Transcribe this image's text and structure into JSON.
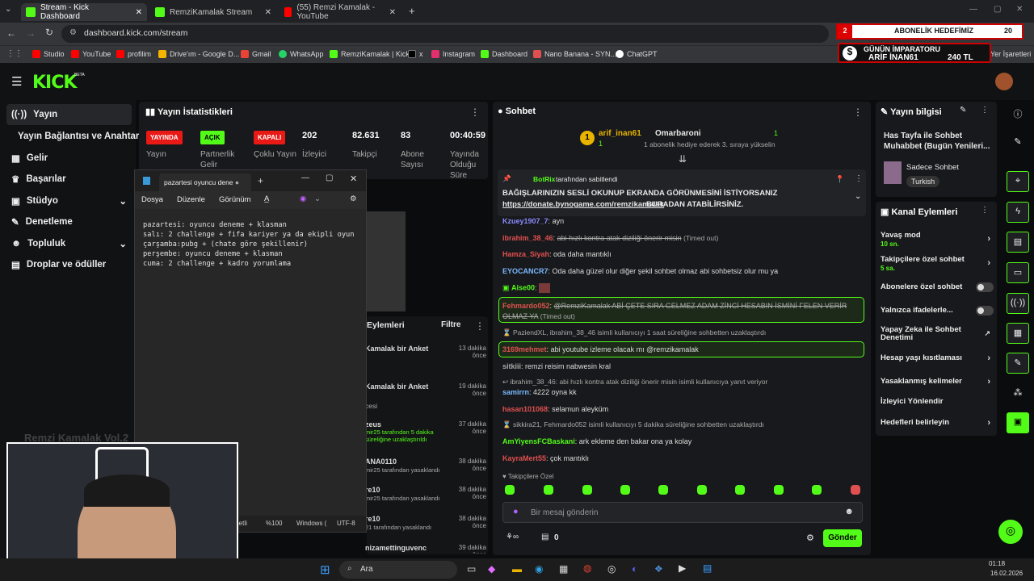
{
  "browser": {
    "tabs": [
      {
        "label": "Stream - Kick Dashboard",
        "color": "#53fc18"
      },
      {
        "label": "RemziKamalak Stream - Wa",
        "color": "#53fc18"
      },
      {
        "label": "(55) Remzi Kamalak - YouTube",
        "color": "#ff0000"
      }
    ],
    "url": "dashboard.kick.com/stream",
    "bookmarks": [
      "Studio",
      "YouTube",
      "profilim",
      "Drive'ım - Google D...",
      "Gmail",
      "WhatsApp",
      "RemziKamalak | Kick",
      "x",
      "Instagram",
      "Dashboard",
      "Nano Banana - SYN...",
      "ChatGPT"
    ],
    "other_bookmarks": "Yer İşaretleri"
  },
  "overlay": {
    "goal_num": "2",
    "goal_label": "ABONELİK HEDEFİMİZ",
    "goal_count": "20",
    "emperor_title": "GÜNÜN İMPARATORU",
    "emperor_name": "ARİF İNAN61",
    "emperor_amount": "240 TL"
  },
  "kick": {
    "logo": "KICK",
    "beta": "BETA"
  },
  "sidebar": {
    "items": [
      {
        "label": "Yayın",
        "icon": "stream-icon"
      },
      {
        "label": "Yayın Bağlantısı ve Anahtarı",
        "icon": "key-icon"
      },
      {
        "label": "Gelir",
        "icon": "money-icon"
      },
      {
        "label": "Başarılar",
        "icon": "trophy-icon"
      },
      {
        "label": "Stüdyo",
        "icon": "studio-icon"
      },
      {
        "label": "Denetleme",
        "icon": "wrench-icon"
      },
      {
        "label": "Topluluk",
        "icon": "people-icon"
      },
      {
        "label": "Droplar ve ödüller",
        "icon": "gift-icon"
      }
    ]
  },
  "stats": {
    "title": "Yayın İstatistikleri",
    "items": [
      {
        "badge": "YAYINDA",
        "badge_color": "#e91916",
        "label": "Yayın"
      },
      {
        "badge": "AÇIK",
        "badge_color": "#53fc18",
        "label": "Partnerlik Gelir"
      },
      {
        "badge": "KAPALI",
        "badge_color": "#e91916",
        "label": "Çoklu Yayın"
      },
      {
        "num": "202",
        "label": "İzleyici"
      },
      {
        "num": "82.631",
        "label": "Takipçi"
      },
      {
        "num": "83",
        "label": "Abone Sayısı"
      },
      {
        "num": "00:40:59",
        "label": "Yayında Olduğu Süre"
      }
    ]
  },
  "activity": {
    "title": "Eylemleri",
    "filter": "Filtre",
    "items": [
      {
        "text": "Kamalak bir Anket",
        "time": "13 dakika önce"
      },
      {
        "text": "Kamalak bir Anket",
        "sub": "cesi",
        "time": "19 dakika önce"
      },
      {
        "text": "zeus",
        "sub": "mir25 tarafından 5 dakika süreliğine uzaklaştırıldı",
        "time": "37 dakika önce"
      },
      {
        "text": "ANA0110",
        "sub": "mir25 tarafından yasaklandı",
        "time": "38 dakika önce"
      },
      {
        "text": "re10",
        "sub": "mir25 tarafından yasaklandı",
        "time": "38 dakika önce"
      },
      {
        "text": "re10",
        "sub": "21 tarafından yasaklandı",
        "time": "38 dakika önce"
      },
      {
        "text": "nizamettinguvenc",
        "time": "39 dakika önce"
      }
    ]
  },
  "notepad": {
    "tab": "pazartesi oyuncu dene",
    "menu": [
      "Dosya",
      "Düzenle",
      "Görünüm"
    ],
    "content": "pazartesi: oyuncu deneme + klasman\nsalı: 2 challenge + fifa kariyer ya da ekipli oyun\nçarşamba:pubg + (chate göre şekillenir)\nperşembe: oyuncu deneme + klasman\ncuma: 2 challenge + kadro yorumlama",
    "status": [
      "metli",
      "%100",
      "Windows (",
      "UTF-8"
    ]
  },
  "webcam": {
    "overlay_text": "Remzi Kamalak Vol.2"
  },
  "chat": {
    "title": "Sohbet",
    "top": {
      "rank": "1",
      "name": "arif_inan61",
      "sub": "1",
      "name2": "Omarbaroni",
      "sub2": "1",
      "gift": "1 abonelik hediye ederek 3. sıraya yükselin"
    },
    "pinned": {
      "by": "BotRix",
      "by_suffix": "tarafından sabitlendi",
      "line1": "BAĞIŞLARINIZIN SESLİ OKUNUP EKRANDA GÖRÜNMESİNİ İSTİYORSANIZ",
      "link": "https://donate.bynogame.com/remzikamalak",
      "line2": "BURADAN ATABİLİRSİNİZ."
    },
    "messages": [
      {
        "user": "Kzuey1907_7",
        "color": "#8a8aff",
        "text": "ayn"
      },
      {
        "user": "ibrahim_38_46",
        "color": "#e05050",
        "text": "abi hızlı kontra atak diziliği önerir misin",
        "note": "(Timed out)"
      },
      {
        "user": "Hamza_Siyah",
        "color": "#e05050",
        "text": "oda daha mantıklı"
      },
      {
        "user": "EYOCANCR7",
        "color": "#7ab8ff",
        "text": "Oda daha güzel olur diğer şekil sohbet olmaz abi sohbetsiz olur mu ya"
      },
      {
        "user": "Aise00",
        "color": "#53fc18",
        "text": ""
      },
      {
        "user": "Fehmardo052",
        "color": "#e05050",
        "text": "@RemziKamalak ABİ ÇETE SIRA GELMEZ ADAM ZİNCİ HESABIN İSMİNİ FELEN VERİR OLMAZ YA",
        "note": "(Timed out)"
      },
      {
        "sys": "PaziendXL, ibrahim_38_46 isimli kullanıcıyı 1 saat süreliğine sohbetten uzaklaştırdı"
      },
      {
        "user": "3169mehmet",
        "color": "#e05050",
        "text": "abi youtube izleme olacak mı @remzikamalak"
      },
      {
        "user": "sitkiii",
        "color": "#aaa",
        "text": "remzi reisim nabwesin kral"
      },
      {
        "sys": "ibrahim_38_46: abi hızlı kontra atak diziliği önerir misin isimli kullanıcıya yanıt veriyor"
      },
      {
        "user": "samirrn",
        "color": "#7ab8ff",
        "text": "4222 oyna kk"
      },
      {
        "user": "hasan101068",
        "color": "#e05050",
        "text": "selamun aleyküm"
      },
      {
        "sys": "sikkira21, Fehmardo052 isimli kullanıcıyı 5 dakika süreliğine sohbetten uzaklaştırdı"
      },
      {
        "user": "AmYiyensFCBaskani",
        "color": "#53fc18",
        "text": "ark ekleme den bakar ona ya kolay"
      },
      {
        "user": "KayraMert55",
        "color": "#e05050",
        "text": "çok mantıklı"
      }
    ],
    "followers_label": "Takipçilere Özel",
    "placeholder": "Bir mesaj gönderin",
    "send": "Gönder",
    "points": "0"
  },
  "info": {
    "title": "Yayın bilgisi",
    "stream_title": "Has Tayfa ile Sohbet Muhabbet (Bugün Yenileri...",
    "category": "Sadece Sohbet",
    "language": "Turkish"
  },
  "channel": {
    "title": "Kanal Eylemleri",
    "items": [
      {
        "label": "Yavaş mod",
        "sub": "10 sn.",
        "kind": "chevron"
      },
      {
        "label": "Takipçilere özel sohbet",
        "sub": "5 sa.",
        "kind": "chevron"
      },
      {
        "label": "Abonelere özel sohbet",
        "kind": "toggle"
      },
      {
        "label": "Yalnızca ifadelerle...",
        "kind": "toggle"
      },
      {
        "label": "Yapay Zeka ile Sohbet Denetimi",
        "kind": "ext"
      },
      {
        "label": "Hesap yaşı kısıtlaması",
        "kind": "chevron"
      },
      {
        "label": "Yasaklanmış kelimeler",
        "kind": "chevron"
      },
      {
        "label": "İzleyici Yönlendir",
        "kind": "none"
      },
      {
        "label": "Hedefleri belirleyin",
        "kind": "chevron"
      }
    ]
  },
  "taskbar": {
    "search": "Ara",
    "time": "01:18",
    "date": "16.02.2026"
  }
}
